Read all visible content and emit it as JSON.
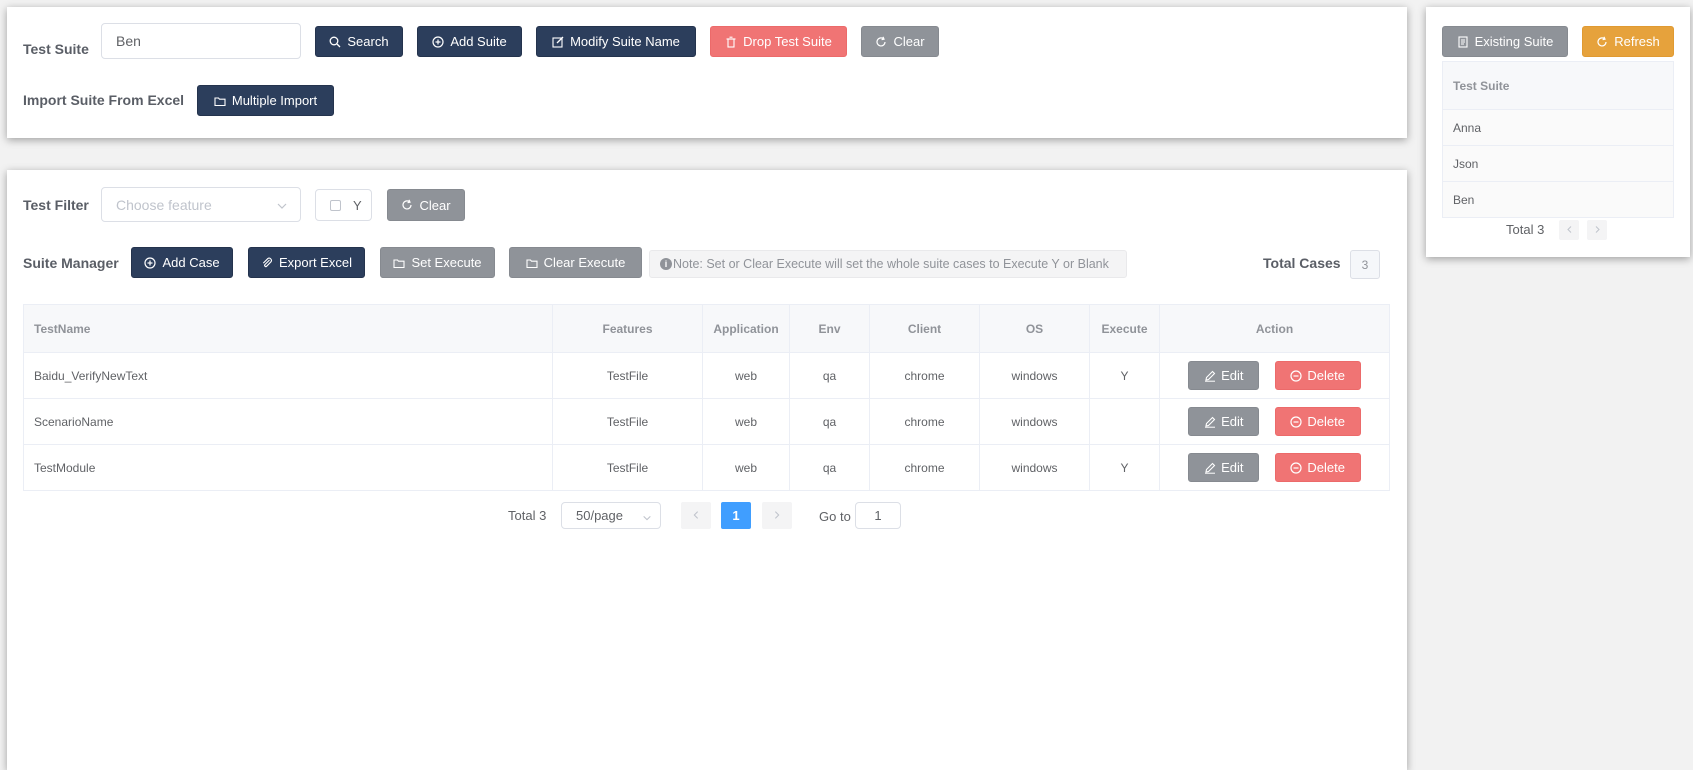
{
  "top": {
    "suite_label": "Test Suite",
    "suite_value": "Ben",
    "search": "Search",
    "add_suite": "Add Suite",
    "modify_suite": "Modify Suite Name",
    "drop_suite": "Drop Test Suite",
    "clear": "Clear",
    "import_label": "Import Suite From Excel",
    "multiple_import": "Multiple Import"
  },
  "filter": {
    "label": "Test Filter",
    "feature_placeholder": "Choose feature",
    "checkbox_label": "Y",
    "clear": "Clear"
  },
  "manager": {
    "label": "Suite Manager",
    "add_case": "Add Case",
    "export_excel": "Export Excel",
    "set_execute": "Set Execute",
    "clear_execute": "Clear Execute",
    "note": "Note: Set or Clear Execute will set the whole suite cases to Execute Y or Blank",
    "total_cases_label": "Total Cases",
    "total_cases_value": "3"
  },
  "table": {
    "headers": [
      "TestName",
      "Features",
      "Application",
      "Env",
      "Client",
      "OS",
      "Execute",
      "Action"
    ],
    "edit_label": "Edit",
    "delete_label": "Delete",
    "rows": [
      {
        "name": "Baidu_VerifyNewText",
        "feature": "TestFile",
        "app": "web",
        "env": "qa",
        "client": "chrome",
        "os": "windows",
        "execute": "Y"
      },
      {
        "name": "ScenarioName",
        "feature": "TestFile",
        "app": "web",
        "env": "qa",
        "client": "chrome",
        "os": "windows",
        "execute": ""
      },
      {
        "name": "TestModule",
        "feature": "TestFile",
        "app": "web",
        "env": "qa",
        "client": "chrome",
        "os": "windows",
        "execute": "Y"
      }
    ]
  },
  "pagination": {
    "total": "Total 3",
    "page_size": "50/page",
    "current_page": "1",
    "goto_label": "Go to",
    "goto_value": "1"
  },
  "side": {
    "existing_suite": "Existing Suite",
    "refresh": "Refresh",
    "header": "Test Suite",
    "items": [
      "Anna",
      "Json",
      "Ben"
    ],
    "total": "Total 3"
  },
  "colors": {
    "dark": "#2c3e5c",
    "red": "#f07474",
    "gray": "#8f9399",
    "orange": "#e6a23c",
    "blue": "#409eff"
  }
}
